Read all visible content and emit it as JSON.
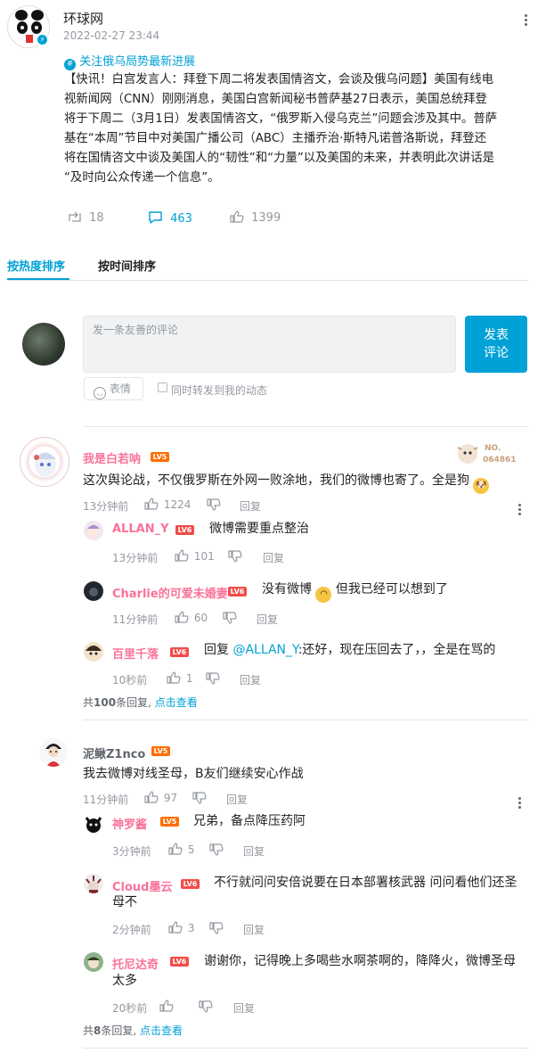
{
  "post": {
    "author": "环球网",
    "time": "2022-02-27 23:44",
    "topic": "关注俄乌局势最新进展",
    "body_lines": [
      "【快讯！白宫发言人：拜登下周二将发表国情咨文，会谈及俄乌问题】美国有线电",
      "视新闻网（CNN）刚刚消息，美国白宫新闻秘书普萨基27日表示，美国总统拜登",
      "将于下周二（3月1日）发表国情咨文，“俄罗斯入侵乌克兰”问题会涉及其中。普萨",
      "基在“本周”节目中对美国广播公司（ABC）主播乔治·斯特凡诺普洛斯说，拜登还",
      "将在国情咨文中谈及美国人的“韧性”和“力量”以及美国的未来，并表明此次讲话是",
      "“及时向公众传递一个信息”。"
    ],
    "reposts": "18",
    "comments": "463",
    "likes": "1399"
  },
  "tabs": {
    "hot": "按热度排序",
    "time": "按时间排序"
  },
  "composer": {
    "placeholder": "发一条友善的评论",
    "submit_line1": "发表",
    "submit_line2": "评论",
    "emoji": "表情",
    "forward": "同时转发到我的动态"
  },
  "comments": [
    {
      "user": "我是白若呐",
      "level": "LV5",
      "text": "这次舆论战，不仅俄罗斯在外网一败涂地，我们的微博也寄了。全是狗",
      "badge_no": "NO.",
      "badge_num": "064861",
      "time": "13分钟前",
      "likes": "1224",
      "reply": "回复",
      "replies": [
        {
          "user": "ALLAN_Y",
          "level": "LV6",
          "text": "微博需要重点整治",
          "time": "13分钟前",
          "likes": "101",
          "reply": "回复"
        },
        {
          "user": "Charlie的可爱未婚妻",
          "level": "LV6",
          "text_a": "没有微博",
          "text_b": "但我已经可以想到了",
          "time": "11分钟前",
          "likes": "60",
          "reply": "回复"
        },
        {
          "user": "百里千落",
          "level": "LV6",
          "prefix": "回复",
          "mention": "@ALLAN_Y",
          "text": ":还好，现在压回去了，，全是在骂的",
          "time": "10秒前",
          "likes": "1",
          "reply": "回复"
        }
      ],
      "more_prefix": "共",
      "more_count": "100",
      "more_suffix": "条回复,",
      "more_link": "点击查看"
    },
    {
      "user": "泥鳅Z1nco",
      "level": "LV5",
      "text": "我去微博对线圣母，B友们继续安心作战",
      "time": "11分钟前",
      "likes": "97",
      "reply": "回复",
      "replies": [
        {
          "user": "神罗酱",
          "level": "LV5",
          "text": "兄弟，备点降压药阿",
          "time": "3分钟前",
          "likes": "5",
          "reply": "回复"
        },
        {
          "user": "Cloud墨云",
          "level": "LV6",
          "text1": "不行就问问安倍说要在日本部署核武器 问问看他们还圣",
          "text2": "母不",
          "time": "2分钟前",
          "likes": "3",
          "reply": "回复"
        },
        {
          "user": "托尼达奇",
          "level": "LV6",
          "text1": "谢谢你，记得晚上多喝些水啊茶啊的，降降火，微博圣母",
          "text2": "太多",
          "time": "20秒前",
          "likes": "",
          "reply": "回复"
        }
      ],
      "more_prefix": "共",
      "more_count": "8",
      "more_suffix": "条回复,",
      "more_link": "点击查看"
    }
  ],
  "colors": {
    "accent": "#00a1d6",
    "pink": "#fb7299",
    "lv5": "#ff6c00",
    "lv6": "#f04c49"
  }
}
